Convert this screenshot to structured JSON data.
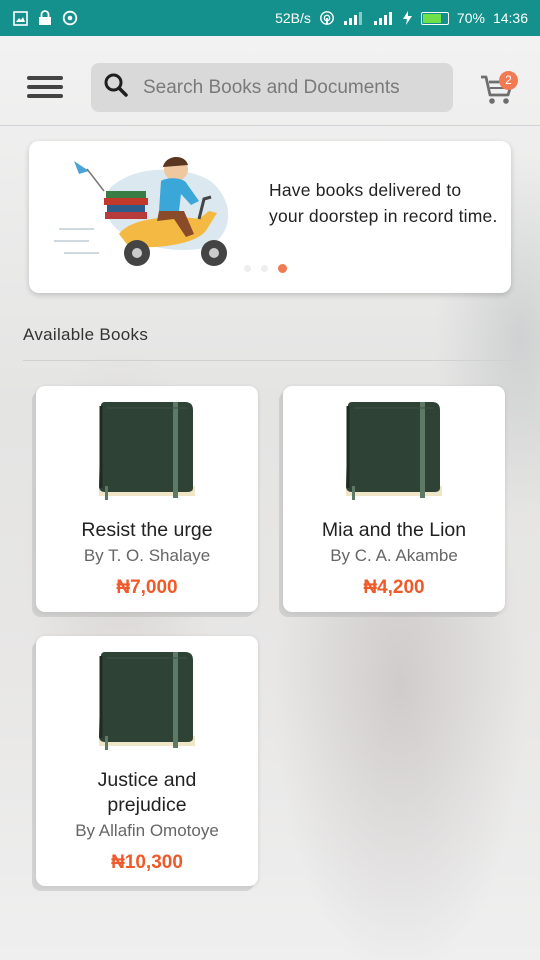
{
  "status_bar": {
    "speed": "52B/s",
    "battery_percent": "70%",
    "time": "14:36"
  },
  "header": {
    "search_placeholder": "Search Books and Documents",
    "cart_count": "2"
  },
  "banner": {
    "text": "Have books delivered to your doorstep in record time.",
    "slide_count": 3,
    "active_slide": 3
  },
  "section": {
    "title": "Available Books"
  },
  "books": [
    {
      "title": "Resist the urge",
      "author": "By T. O. Shalaye",
      "price": "₦7,000"
    },
    {
      "title": "Mia and the Lion",
      "author": "By C. A. Akambe",
      "price": "₦4,200"
    },
    {
      "title": "Justice and prejudice",
      "author": "By Allafin Omotoye",
      "price": "₦10,300"
    }
  ],
  "colors": {
    "status_bar": "#14918c",
    "accent": "#f27a52",
    "price": "#ee5a2a",
    "book_cover": "#2f4236"
  },
  "icons": {
    "menu": "hamburger-icon",
    "search": "search-icon",
    "cart": "cart-icon"
  }
}
